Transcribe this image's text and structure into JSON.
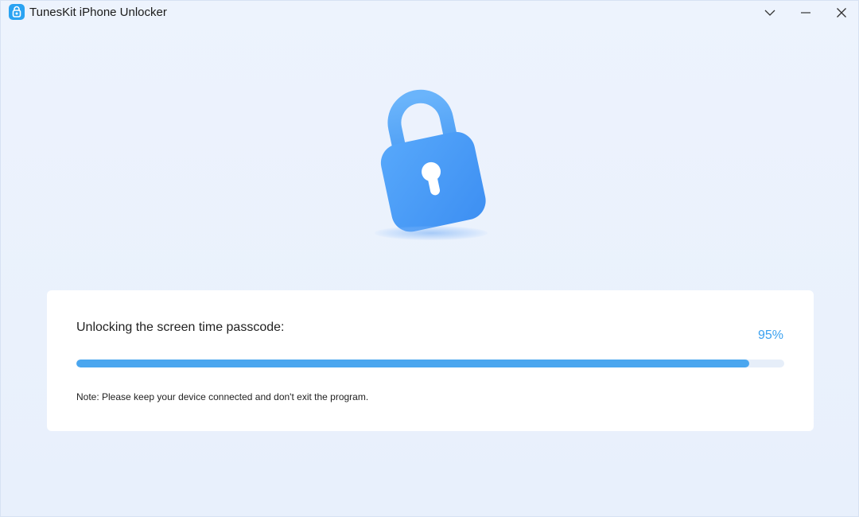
{
  "window": {
    "title": "TunesKit iPhone Unlocker",
    "logo_icon": "unlock-logo-icon",
    "controls": [
      "chevron-down-icon",
      "minimize-icon",
      "close-icon"
    ]
  },
  "hero": {
    "icon": "padlock-icon",
    "accent": "#4a9ef5"
  },
  "progress": {
    "label": "Unlocking the screen time passcode:",
    "percent_text": "95%",
    "value": 0.95,
    "color": "#4aa6ef",
    "note": "Note: Please keep your device connected and don't exit the program."
  }
}
